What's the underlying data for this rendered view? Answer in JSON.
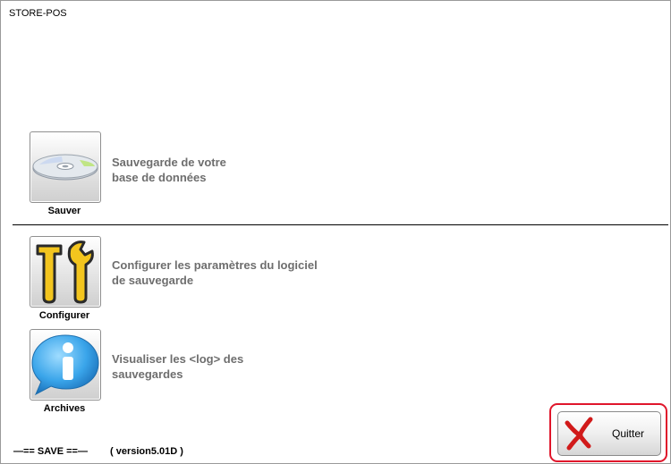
{
  "window": {
    "title": "STORE-POS"
  },
  "actions": [
    {
      "label": "Sauver",
      "icon": "disc-icon",
      "description_line1": "Sauvegarde de votre",
      "description_line2": "base de données"
    },
    {
      "label": "Configurer",
      "icon": "tools-icon",
      "description_line1": "Configurer les paramètres du logiciel",
      "description_line2": "de sauvegarde"
    },
    {
      "label": "Archives",
      "icon": "info-bubble-icon",
      "description_line1": "Visualiser les <log> des",
      "description_line2": "sauvegardes"
    }
  ],
  "footer": {
    "save_text": "—== SAVE ==—",
    "version_text": "( version5.01D )"
  },
  "quit": {
    "label": "Quitter",
    "icon": "red-x-icon",
    "highlight_color": "#e0162b"
  },
  "colors": {
    "description_text": "#6e6e6e",
    "separator": "#000000"
  }
}
